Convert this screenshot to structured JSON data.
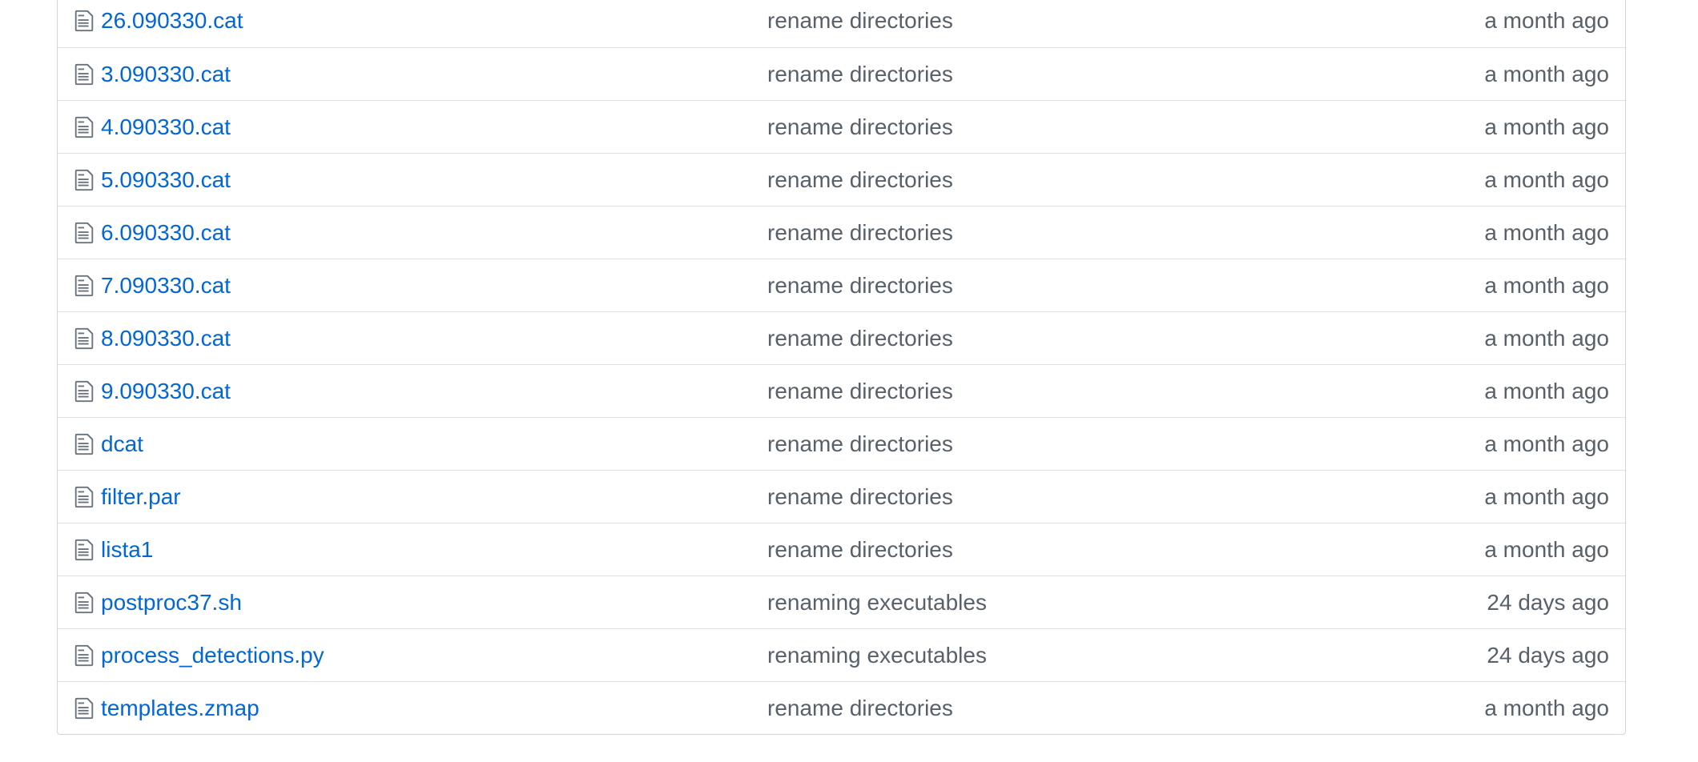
{
  "colors": {
    "link": "#0366d6",
    "secondary_text": "#586069",
    "icon": "#6a737d",
    "border": "#dfe2e5"
  },
  "file_icon": "file-text-icon",
  "files": [
    {
      "name": "26.090330.cat",
      "message": "rename directories",
      "age": "a month ago"
    },
    {
      "name": "3.090330.cat",
      "message": "rename directories",
      "age": "a month ago"
    },
    {
      "name": "4.090330.cat",
      "message": "rename directories",
      "age": "a month ago"
    },
    {
      "name": "5.090330.cat",
      "message": "rename directories",
      "age": "a month ago"
    },
    {
      "name": "6.090330.cat",
      "message": "rename directories",
      "age": "a month ago"
    },
    {
      "name": "7.090330.cat",
      "message": "rename directories",
      "age": "a month ago"
    },
    {
      "name": "8.090330.cat",
      "message": "rename directories",
      "age": "a month ago"
    },
    {
      "name": "9.090330.cat",
      "message": "rename directories",
      "age": "a month ago"
    },
    {
      "name": "dcat",
      "message": "rename directories",
      "age": "a month ago"
    },
    {
      "name": "filter.par",
      "message": "rename directories",
      "age": "a month ago"
    },
    {
      "name": "lista1",
      "message": "rename directories",
      "age": "a month ago"
    },
    {
      "name": "postproc37.sh",
      "message": "renaming executables",
      "age": "24 days ago"
    },
    {
      "name": "process_detections.py",
      "message": "renaming executables",
      "age": "24 days ago"
    },
    {
      "name": "templates.zmap",
      "message": "rename directories",
      "age": "a month ago"
    }
  ]
}
